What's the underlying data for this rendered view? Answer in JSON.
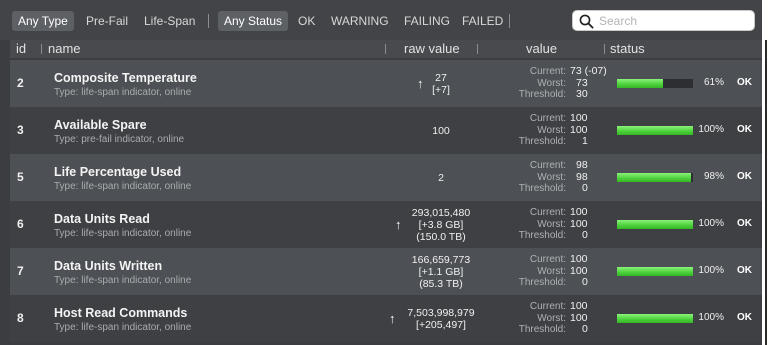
{
  "toolbar": {
    "type_filters": [
      "Any Type",
      "Pre-Fail",
      "Life-Span"
    ],
    "status_filters": [
      "Any Status",
      "OK",
      "WARNING",
      "FAILING",
      "FAILED"
    ],
    "search_placeholder": "Search"
  },
  "columns": {
    "id": "id",
    "name": "name",
    "raw": "raw value",
    "value": "value",
    "status": "status"
  },
  "labels": {
    "current": "Current:",
    "worst": "Worst:",
    "threshold": "Threshold:"
  },
  "rows": [
    {
      "id": "2",
      "name": "Composite Temperature",
      "type": "Type: life-span indicator, online",
      "raw": [
        "27",
        "[+7]"
      ],
      "arrow": true,
      "current": "73  (-07)",
      "worst": "73",
      "threshold": "30",
      "pct_text": "61%",
      "pct": 61,
      "status": "OK"
    },
    {
      "id": "3",
      "name": "Available Spare",
      "type": "Type: pre-fail indicator, online",
      "raw": [
        "100"
      ],
      "arrow": false,
      "current": "100",
      "worst": "100",
      "threshold": "1",
      "pct_text": "100%",
      "pct": 100,
      "status": "OK"
    },
    {
      "id": "5",
      "name": "Life Percentage Used",
      "type": "Type: life-span indicator, online",
      "raw": [
        "2"
      ],
      "arrow": false,
      "current": "98",
      "worst": "98",
      "threshold": "0",
      "pct_text": "98%",
      "pct": 98,
      "status": "OK"
    },
    {
      "id": "6",
      "name": "Data Units Read",
      "type": "Type: life-span indicator, online",
      "raw": [
        "293,015,480",
        "[+3.8 GB]",
        "(150.0 TB)"
      ],
      "arrow": true,
      "current": "100",
      "worst": "100",
      "threshold": "0",
      "pct_text": "100%",
      "pct": 100,
      "status": "OK"
    },
    {
      "id": "7",
      "name": "Data Units Written",
      "type": "Type: life-span indicator, online",
      "raw": [
        "166,659,773",
        "[+1.1 GB]",
        "(85.3 TB)"
      ],
      "arrow": false,
      "current": "100",
      "worst": "100",
      "threshold": "0",
      "pct_text": "100%",
      "pct": 100,
      "status": "OK"
    },
    {
      "id": "8",
      "name": "Host Read Commands",
      "type": "Type: life-span indicator, online",
      "raw": [
        "7,503,998,979",
        "[+205,497]"
      ],
      "arrow": true,
      "current": "100",
      "worst": "100",
      "threshold": "0",
      "pct_text": "100%",
      "pct": 100,
      "status": "OK"
    }
  ]
}
